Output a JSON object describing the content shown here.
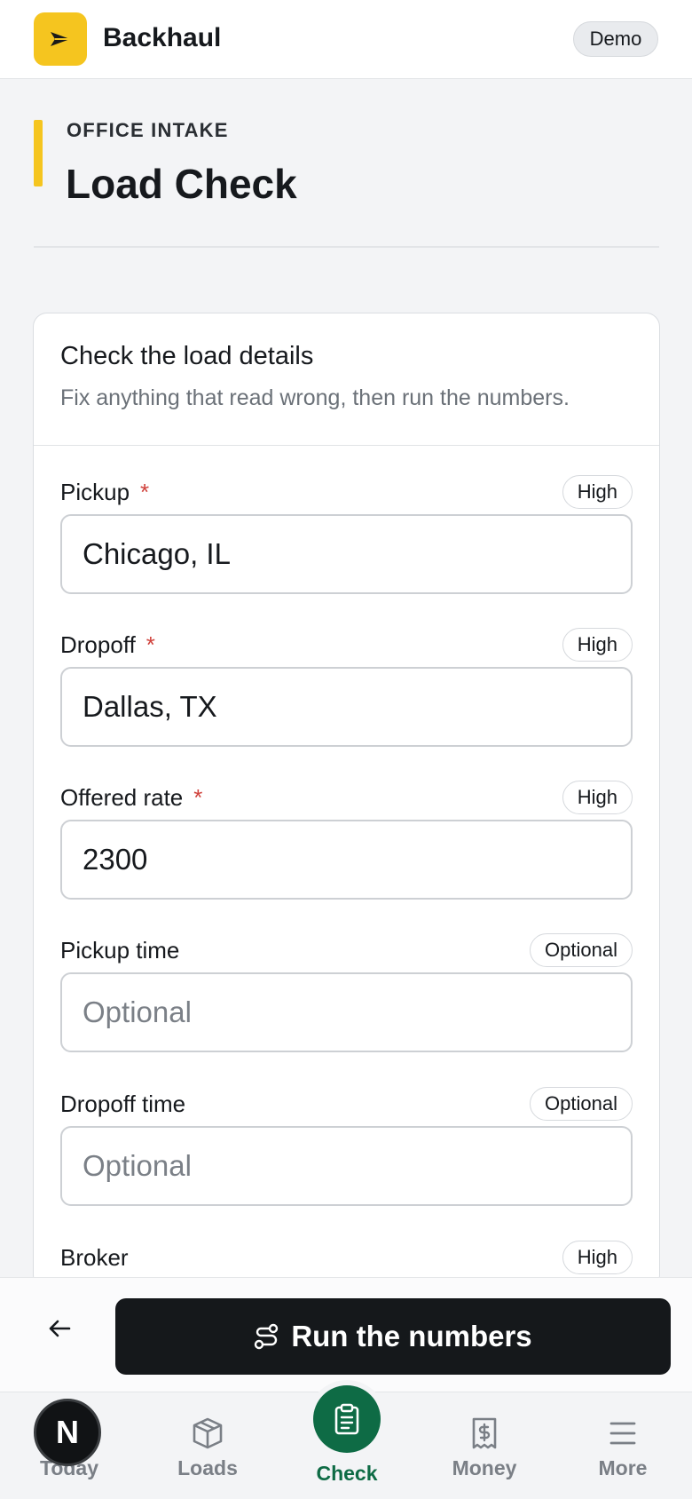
{
  "header": {
    "app_name": "Backhaul",
    "mode_badge": "Demo",
    "logo_icon": "paper-plane-icon",
    "brand_color": "#f5c51f"
  },
  "page": {
    "eyebrow": "OFFICE INTAKE",
    "title": "Load Check"
  },
  "card": {
    "title": "Check the load details",
    "subtitle": "Fix anything that read wrong, then run the numbers."
  },
  "fields": [
    {
      "label": "Pickup",
      "required": "*",
      "confidence": "High",
      "value": "Chicago, IL",
      "placeholder": ""
    },
    {
      "label": "Dropoff",
      "required": "*",
      "confidence": "High",
      "value": "Dallas, TX",
      "placeholder": ""
    },
    {
      "label": "Offered rate",
      "required": "*",
      "confidence": "High",
      "value": "2300",
      "placeholder": ""
    },
    {
      "label": "Pickup time",
      "required": "",
      "confidence": "Optional",
      "value": "",
      "placeholder": "Optional"
    },
    {
      "label": "Dropoff time",
      "required": "",
      "confidence": "Optional",
      "value": "",
      "placeholder": "Optional"
    },
    {
      "label": "Broker",
      "required": "",
      "confidence": "High",
      "value": "",
      "placeholder": ""
    }
  ],
  "actions": {
    "back_icon": "arrow-left-icon",
    "run_label": "Run the numbers",
    "run_icon": "route-icon"
  },
  "nav": {
    "items": [
      {
        "label": "Today",
        "icon": "sun-icon"
      },
      {
        "label": "Loads",
        "icon": "box-icon"
      },
      {
        "label": "Check",
        "icon": "clipboard-icon",
        "active": true
      },
      {
        "label": "Money",
        "icon": "receipt-dollar-icon"
      },
      {
        "label": "More",
        "icon": "menu-icon"
      }
    ],
    "active_color": "#0e6b45",
    "overlay_badge": "N"
  }
}
